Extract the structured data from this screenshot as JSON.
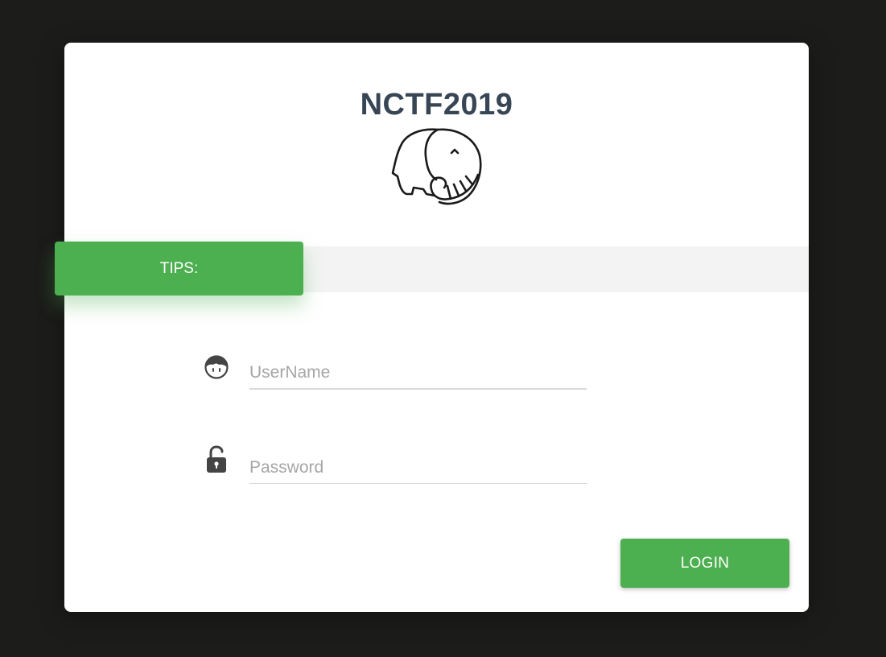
{
  "header": {
    "title": "NCTF2019",
    "logo_icon": "elephant-icon"
  },
  "tips": {
    "label": "TIPS:",
    "message": ""
  },
  "form": {
    "username": {
      "icon": "user-face-icon",
      "placeholder": "UserName",
      "value": ""
    },
    "password": {
      "icon": "unlock-icon",
      "placeholder": "Password",
      "value": ""
    },
    "login_label": "LOGIN"
  },
  "colors": {
    "background": "#1c1c1a",
    "card": "#ffffff",
    "accent": "#4caf50",
    "title": "#374555",
    "tips_bar": "#f3f3f3"
  }
}
